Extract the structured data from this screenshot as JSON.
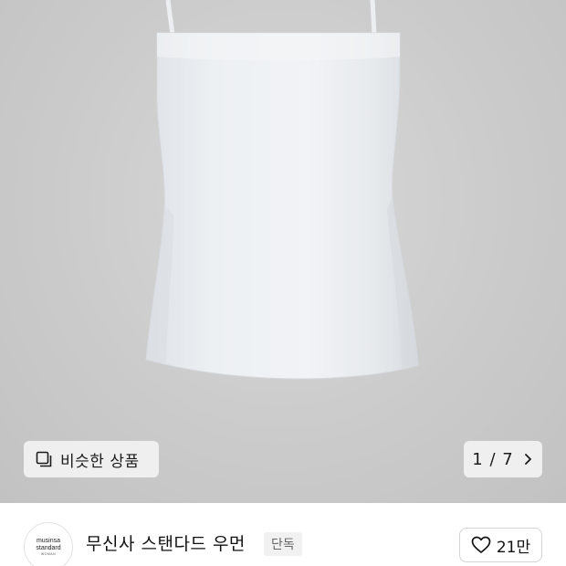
{
  "hero": {
    "image_alt_subject": "white camisole top",
    "similar_products_label": "비슷한 상품",
    "similar_icon": "copy-icon",
    "pager_current": "1",
    "pager_total": "7",
    "pager_text": "1 / 7",
    "pager_icon": "chevron-right-icon"
  },
  "brand": {
    "logo_line1": "musinsa",
    "logo_line2": "standard",
    "logo_line3": "WOMAN",
    "name": "무신사 스탠다드 우먼",
    "badge": "단독"
  },
  "like": {
    "icon": "heart-icon",
    "count": "21만"
  },
  "colors": {
    "hero_bg": "#c9c9c9",
    "button_bg": "#efefef",
    "badge_bg": "#f1f1f1",
    "badge_text": "#666666"
  }
}
